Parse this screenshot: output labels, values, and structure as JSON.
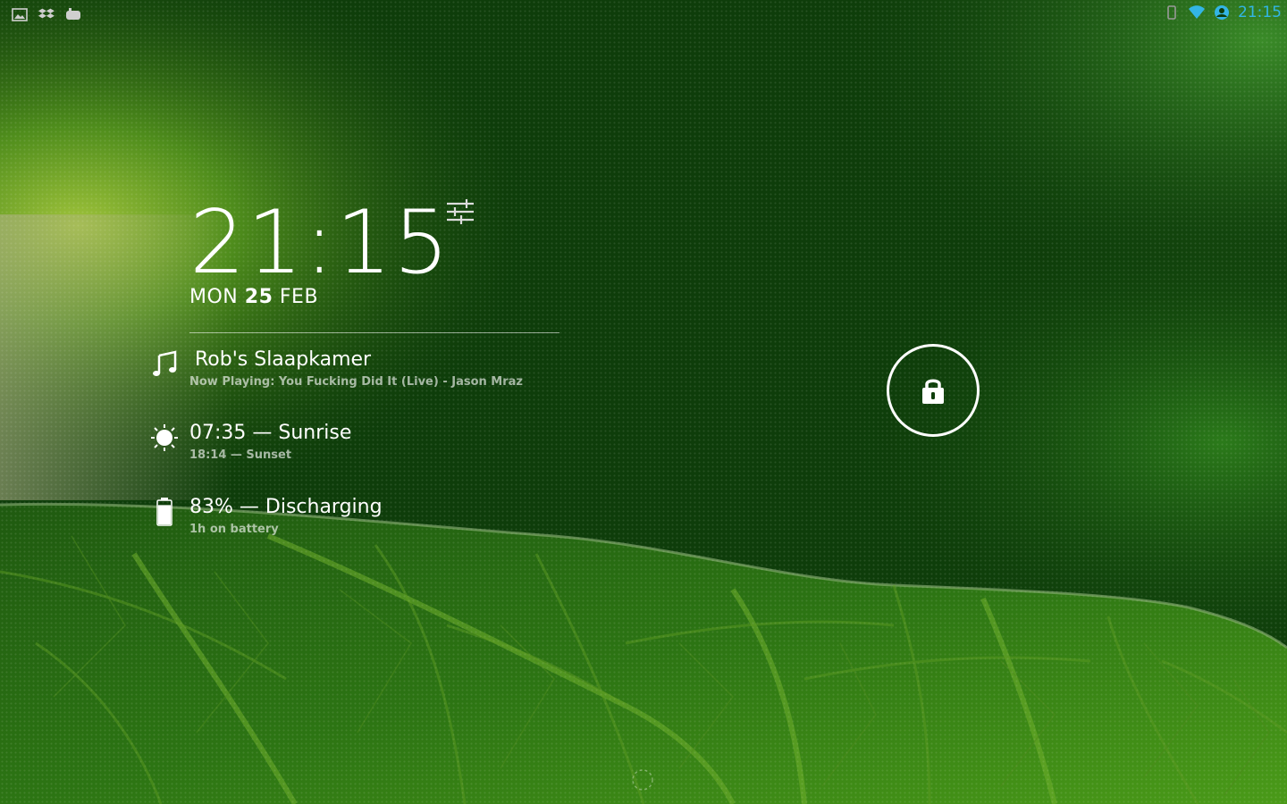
{
  "status_bar": {
    "left_icons": [
      "gallery-icon",
      "dropbox-icon",
      "notification-icon"
    ],
    "right_icons": [
      "vibrate-icon",
      "wifi-icon",
      "account-icon"
    ],
    "time": "21:15",
    "accent_color": "#33b5e5"
  },
  "clock": {
    "time": "21:15",
    "weekday": "MON",
    "day": "25",
    "month": "FEB"
  },
  "widgets": {
    "music": {
      "icon": "music-note-icon",
      "title": "Rob's Slaapkamer",
      "subtitle": "Now Playing:  You Fucking Did It (Live) -  Jason Mraz"
    },
    "sun": {
      "icon": "sun-icon",
      "title": "07:35 — Sunrise",
      "subtitle": "18:14 — Sunset"
    },
    "battery": {
      "icon": "battery-icon",
      "title": "83% — Discharging",
      "subtitle": "1h on battery",
      "level_percent": 83
    }
  },
  "lock": {
    "icon": "lock-icon"
  },
  "colors": {
    "wallpaper_base": "#0d3d0a",
    "leaf": "#2f7a12"
  }
}
